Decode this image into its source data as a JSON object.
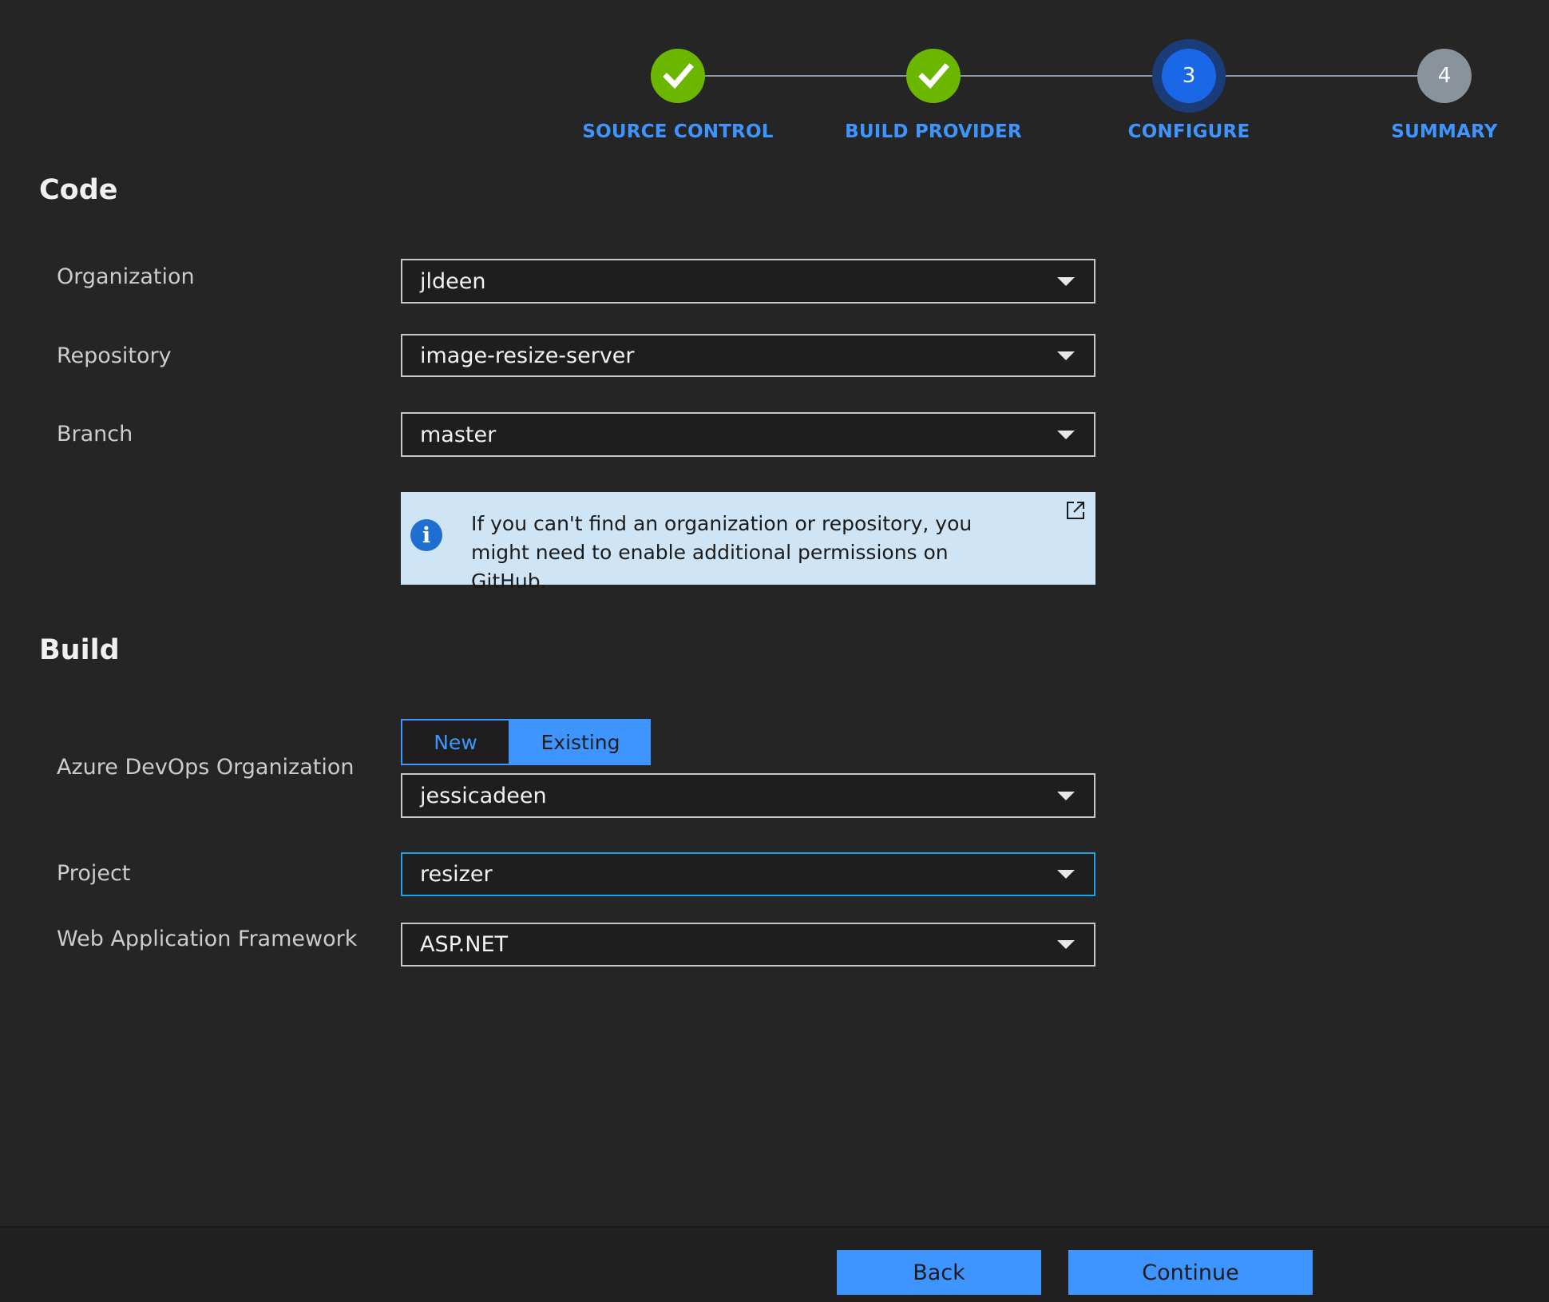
{
  "stepper": {
    "steps": [
      {
        "label": "SOURCE CONTROL",
        "state": "done",
        "number": ""
      },
      {
        "label": "BUILD PROVIDER",
        "state": "done",
        "number": ""
      },
      {
        "label": "CONFIGURE",
        "state": "active",
        "number": "3"
      },
      {
        "label": "SUMMARY",
        "state": "pending",
        "number": "4"
      }
    ]
  },
  "code": {
    "title": "Code",
    "organization": {
      "label": "Organization",
      "value": "jldeen"
    },
    "repository": {
      "label": "Repository",
      "value": "image-resize-server"
    },
    "branch": {
      "label": "Branch",
      "value": "master"
    },
    "info": {
      "icon": "info-icon",
      "text": "If you can't find an organization or repository, you might need to enable additional permissions on GitHub."
    }
  },
  "build": {
    "title": "Build",
    "azure_org": {
      "label": "Azure DevOps Organization",
      "toggle_new": "New",
      "toggle_existing": "Existing",
      "selected_toggle": "Existing",
      "value": "jessicadeen"
    },
    "project": {
      "label": "Project",
      "value": "resizer"
    },
    "framework": {
      "label": "Web Application Framework",
      "value": "ASP.NET"
    }
  },
  "footer": {
    "back_label": "Back",
    "continue_label": "Continue"
  },
  "colors": {
    "accent": "#3f95ff",
    "done": "#6bb700",
    "active": "#1a68e8",
    "pending": "#8a929c",
    "info_background": "#cfe4f5"
  }
}
